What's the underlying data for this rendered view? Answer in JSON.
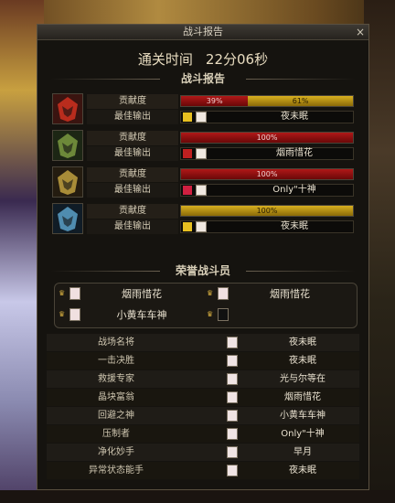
{
  "window": {
    "title": "战斗报告",
    "close_glyph": "×"
  },
  "clear": {
    "label": "通关时间",
    "time": "22分06秒"
  },
  "sections": {
    "battle": "战斗报告",
    "honor": "荣誉战斗员"
  },
  "labels": {
    "contribution": "贡献度",
    "best_output": "最佳输出"
  },
  "players": [
    {
      "icon": "red-warrior-icon",
      "segments": [
        {
          "pct": 39,
          "label": "39%",
          "color": "red"
        },
        {
          "pct": 61,
          "label": "61%",
          "color": "gold"
        }
      ],
      "best_name": "夜未眠",
      "skill_color": "#e8c020"
    },
    {
      "icon": "green-warrior-icon",
      "segments": [
        {
          "pct": 100,
          "label": "100%",
          "color": "red"
        }
      ],
      "best_name": "烟雨惜花",
      "skill_color": "#c02020"
    },
    {
      "icon": "gold-warrior-icon",
      "segments": [
        {
          "pct": 100,
          "label": "100%",
          "color": "red"
        }
      ],
      "best_name": "Only\"十神",
      "skill_color": "#d02040"
    },
    {
      "icon": "blue-warrior-icon",
      "segments": [
        {
          "pct": 100,
          "label": "100%",
          "color": "gold"
        }
      ],
      "best_name": "夜未眠",
      "skill_color": "#e8c020"
    }
  ],
  "honor": [
    {
      "name": "烟雨惜花"
    },
    {
      "name": "烟雨惜花"
    },
    {
      "name": "小黄车车神"
    },
    {
      "name": ""
    }
  ],
  "awards": [
    {
      "title": "战场名将",
      "name": "夜未眠"
    },
    {
      "title": "一击决胜",
      "name": "夜未眠"
    },
    {
      "title": "救援专家",
      "name": "光与尔等在"
    },
    {
      "title": "晶块富翁",
      "name": "烟雨惜花"
    },
    {
      "title": "回避之神",
      "name": "小黄车车神"
    },
    {
      "title": "压制者",
      "name": "Only\"十神"
    },
    {
      "title": "净化妙手",
      "name": "早月"
    },
    {
      "title": "异常状态能手",
      "name": "夜未眠"
    }
  ],
  "colors": {
    "accent_red": "#b01818",
    "accent_gold": "#d8b020"
  }
}
